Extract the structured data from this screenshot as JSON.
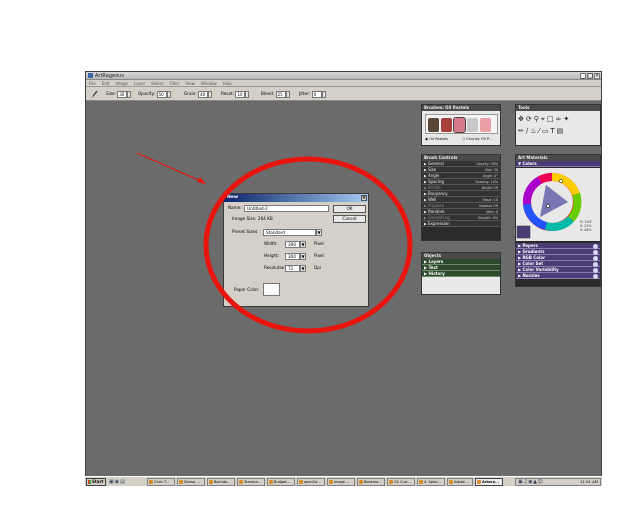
{
  "app": {
    "title": "ArtRageous",
    "window_buttons": [
      "_",
      "□",
      "×"
    ],
    "menu": [
      "File",
      "Edit",
      "Image",
      "Layer",
      "Select",
      "Filter",
      "View",
      "Window",
      "Help"
    ]
  },
  "toolbar": {
    "size_label": "Size:",
    "size_value": "30",
    "opacity_label": "Opacity:",
    "opacity_value": "50",
    "grain_label": "Grain:",
    "grain_value": "40",
    "resat_label": "Resat:",
    "resat_value": "10",
    "bleed_label": "Bleed:",
    "bleed_value": "25",
    "jitter_label": "Jitter:",
    "jitter_value": "0"
  },
  "brushes_panel": {
    "title": "Brushes: Oil Pastels",
    "option_1": "Oil Pastels",
    "option_2": "Chunky Oil P..."
  },
  "brush_controls": {
    "title": "Brush Controls",
    "rows": [
      {
        "label": "General",
        "value": "Opacity: 30%"
      },
      {
        "label": "Size",
        "value": "Size: 30"
      },
      {
        "label": "Angle",
        "value": "Angle: 0°"
      },
      {
        "label": "Spacing",
        "value": "Spacing: 10%"
      },
      {
        "label": "Bristle",
        "value": "Bristle Off"
      },
      {
        "label": "Buoyancy",
        "value": ""
      },
      {
        "label": "Well",
        "value": "Resat: 10"
      },
      {
        "label": "Impasto",
        "value": "Impasto Off"
      },
      {
        "label": "Random",
        "value": "Jitter: 0"
      },
      {
        "label": "Smoothing",
        "value": "Smooth: 0%"
      },
      {
        "label": "Expression",
        "value": ""
      }
    ]
  },
  "objects_panel": {
    "title": "Objects",
    "items": [
      "Layers",
      "Text",
      "History"
    ]
  },
  "tools_panel": {
    "title": "Tools"
  },
  "art_materials": {
    "title": "Art Materials",
    "colors_label": "Colors",
    "hsv": [
      "H: 244°",
      "S: 23%",
      "V: 46%"
    ],
    "sections": [
      "Papers",
      "Gradients",
      "RGB Color",
      "Color Set",
      "Color Variability",
      "Nozzles"
    ]
  },
  "dialog": {
    "title": "New",
    "name_label": "Name:",
    "name_value": "Untitled-2",
    "ok_label": "OK",
    "cancel_label": "Cancel",
    "image_size": "Image Size: 264 KB",
    "preset_label": "Preset Sizes:",
    "preset_value": "Standard",
    "width_label": "Width:",
    "width_value": "300",
    "width_unit": "Pixel",
    "height_label": "Height:",
    "height_value": "300",
    "height_unit": "Pixel",
    "resolution_label": "Resolution:",
    "resolution_value": "72",
    "resolution_unit": "Dpi",
    "paper_color_label": "Paper Color:"
  },
  "taskbar": {
    "start_label": "Start",
    "items": [
      "Chris T...",
      "Stomp ...",
      "Bachdo...",
      "Tamana...",
      "Budget...",
      "openCa...",
      "image ...",
      "Bookma...",
      "O2 Curr...",
      "4. Aphe...",
      "Adobe ...",
      "Artoca..."
    ],
    "clock": "11:01 AM"
  },
  "colors": {
    "annotation_red": "#e8150f",
    "canvas_gray": "#6b6b6b",
    "row_green": "#2e4a2e",
    "row_purple": "#4b3c76"
  }
}
